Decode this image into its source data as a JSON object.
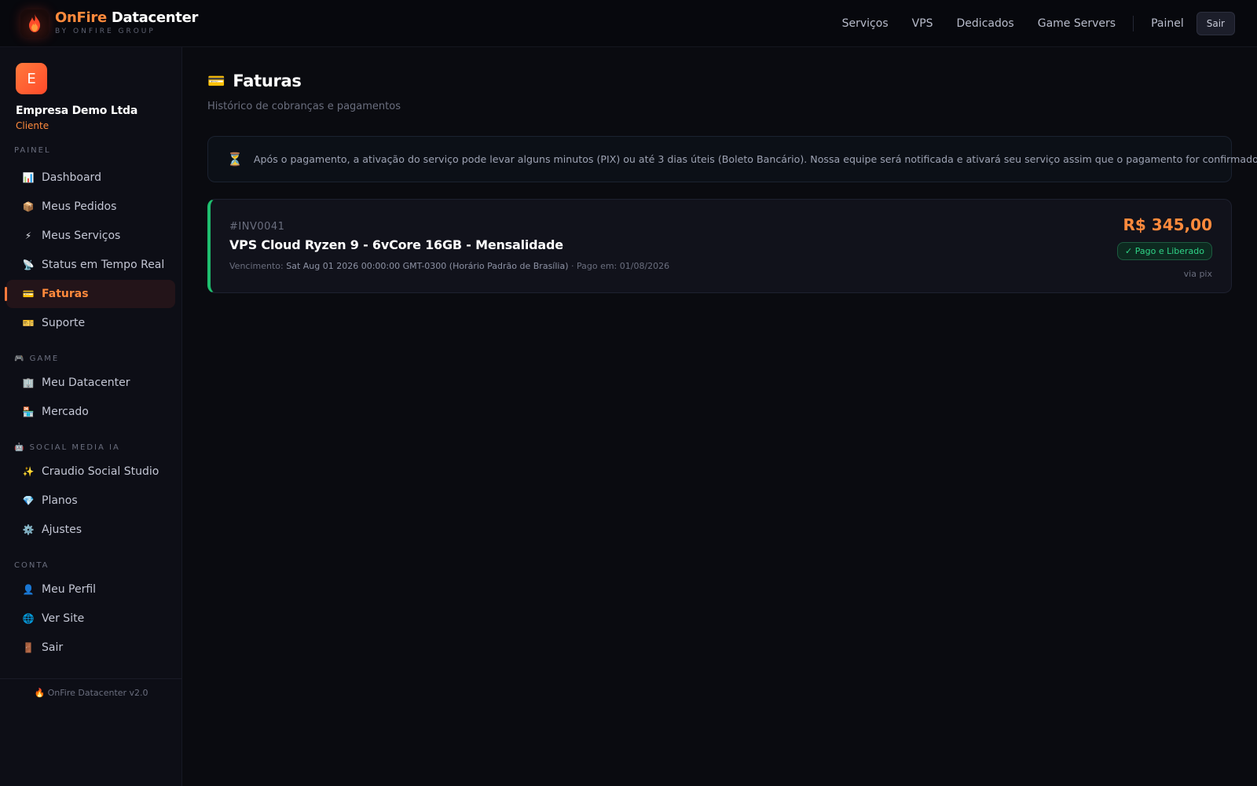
{
  "brand": {
    "name_accent": "OnFire",
    "name_rest": "Datacenter",
    "subtitle": "BY ONFIRE GROUP",
    "logo_icon": "flame-icon",
    "accent_color": "#ff8a3c"
  },
  "topnav": {
    "links": [
      "Serviços",
      "VPS",
      "Dedicados",
      "Game Servers"
    ],
    "painel": "Painel",
    "sair": "Sair"
  },
  "user": {
    "initial": "E",
    "company": "Empresa Demo Ltda",
    "role": "Cliente"
  },
  "sidebar": {
    "sections": [
      {
        "label": "PAINEL",
        "items": [
          {
            "icon": "chart-icon",
            "glyph": "📊",
            "label": "Dashboard",
            "active": false
          },
          {
            "icon": "package-icon",
            "glyph": "📦",
            "label": "Meus Pedidos",
            "active": false
          },
          {
            "icon": "lightning-icon",
            "glyph": "⚡",
            "label": "Meus Serviços",
            "active": false
          },
          {
            "icon": "satellite-icon",
            "glyph": "📡",
            "label": "Status em Tempo Real",
            "active": false
          },
          {
            "icon": "credit-card-icon",
            "glyph": "💳",
            "label": "Faturas",
            "active": true
          },
          {
            "icon": "ticket-icon",
            "glyph": "🎫",
            "label": "Suporte",
            "active": false
          }
        ]
      },
      {
        "label": "GAME",
        "icon": "gamepad-icon",
        "glyph": "🎮",
        "items": [
          {
            "icon": "building-icon",
            "glyph": "🏢",
            "label": "Meu Datacenter",
            "active": false
          },
          {
            "icon": "store-icon",
            "glyph": "🏪",
            "label": "Mercado",
            "active": false
          }
        ]
      },
      {
        "label": "SOCIAL MEDIA IA",
        "icon": "robot-icon",
        "glyph": "🤖",
        "items": [
          {
            "icon": "sparkles-icon",
            "glyph": "✨",
            "label": "Craudio Social Studio",
            "active": false
          },
          {
            "icon": "gem-icon",
            "glyph": "💎",
            "label": "Planos",
            "active": false
          },
          {
            "icon": "gear-icon",
            "glyph": "⚙️",
            "label": "Ajustes",
            "active": false
          }
        ]
      },
      {
        "label": "CONTA",
        "items": [
          {
            "icon": "user-icon",
            "glyph": "👤",
            "label": "Meu Perfil",
            "active": false
          },
          {
            "icon": "globe-icon",
            "glyph": "🌐",
            "label": "Ver Site",
            "active": false
          },
          {
            "icon": "door-icon",
            "glyph": "🚪",
            "label": "Sair",
            "active": false
          }
        ]
      }
    ],
    "footer": "OnFire Datacenter v2.0",
    "footer_glyph": "🔥"
  },
  "page": {
    "title_glyph": "💳",
    "title": "Faturas",
    "subtitle": "Histórico de cobranças e pagamentos"
  },
  "notice": {
    "glyph": "⏳",
    "text": "Após o pagamento, a ativação do serviço pode levar alguns minutos (PIX) ou até 3 dias úteis (Boleto Bancário). Nossa equipe será notificada e ativará seu serviço assim que o pagamento for confirmado."
  },
  "invoices": [
    {
      "id": "#INV0041",
      "title": "VPS Cloud Ryzen 9 - 6vCore 16GB - Mensalidade",
      "due_label": "Vencimento: ",
      "due_value": "Sat Aug 01 2026 00:00:00 GMT-0300 (Horário Padrão de Brasília)",
      "paid_label": " · Pago em: 01/08/2026",
      "amount": "R$ 345,00",
      "status": "✓ Pago e Liberado",
      "method": "via pix",
      "status_color": "#2fd487"
    }
  ]
}
